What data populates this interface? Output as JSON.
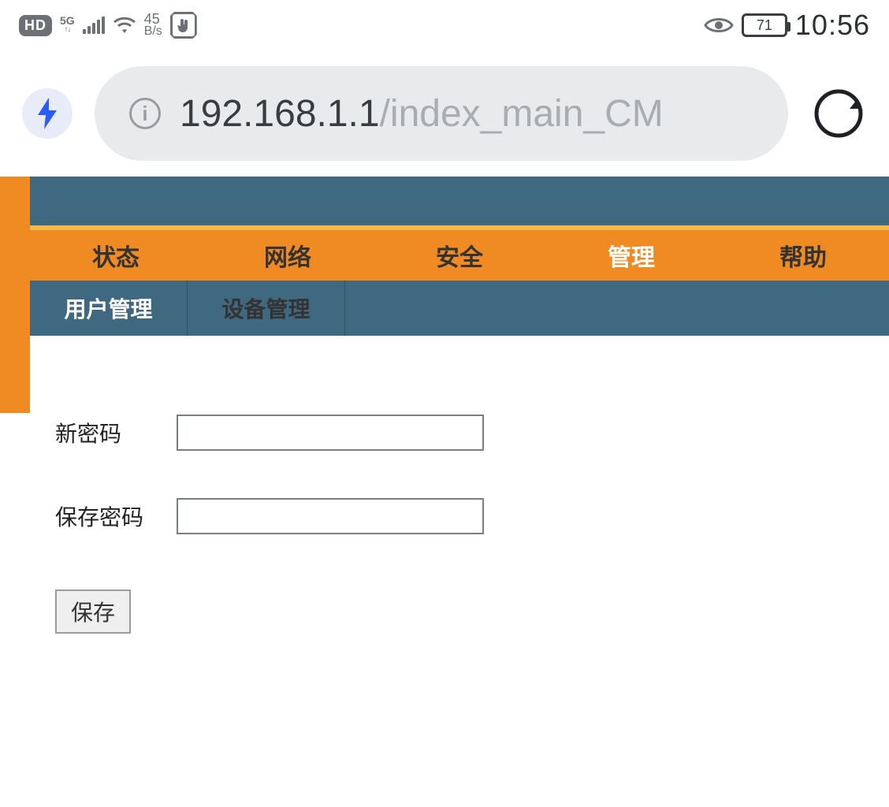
{
  "statusbar": {
    "hd": "HD",
    "network_label": "5G",
    "rate_value": "45",
    "rate_unit": "B/s",
    "battery": "71",
    "clock": "10:56"
  },
  "browser": {
    "url_host": "192.168.1.1",
    "url_path": "/index_main_CM"
  },
  "nav": {
    "tabs": [
      "状态",
      "网络",
      "安全",
      "管理",
      "帮助"
    ],
    "active_index": 3,
    "subtabs": [
      "用户管理",
      "设备管理"
    ],
    "sub_active_index": 0
  },
  "form": {
    "new_password_label": "新密码",
    "confirm_password_label": "保存密码",
    "new_password_value": "",
    "confirm_password_value": "",
    "save_button": "保存"
  }
}
